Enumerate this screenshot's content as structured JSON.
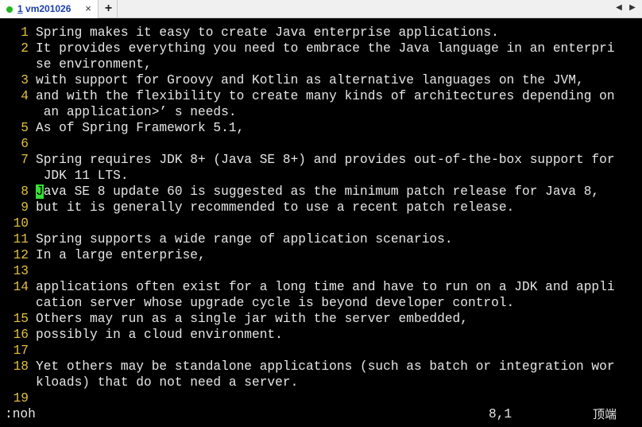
{
  "tabbar": {
    "active_tab": {
      "index": "1",
      "name": " vm201026",
      "close_glyph": "×",
      "status_color": "#1fb81f"
    },
    "add_tab_glyph": "+",
    "prev_glyph": "◀",
    "next_glyph": "▶"
  },
  "editor": {
    "rows": [
      {
        "num": "1",
        "text": "Spring makes it easy to create Java enterprise applications."
      },
      {
        "num": "2",
        "text": "It provides everything you need to embrace the Java language in an enterpri"
      },
      {
        "num": "",
        "text": "se environment,"
      },
      {
        "num": "3",
        "text": "with support for Groovy and Kotlin as alternative languages on the JVM,"
      },
      {
        "num": "4",
        "text": "and with the flexibility to create many kinds of architectures depending on"
      },
      {
        "num": "",
        "text": " an application>’ s needs."
      },
      {
        "num": "5",
        "text": "As of Spring Framework 5.1,"
      },
      {
        "num": "6",
        "text": ""
      },
      {
        "num": "7",
        "text": "Spring requires JDK 8+ (Java SE 8+) and provides out-of-the-box support for"
      },
      {
        "num": "",
        "text": " JDK 11 LTS."
      },
      {
        "num": "8",
        "cursor_char": "J",
        "text": "ava SE 8 update 60 is suggested as the minimum patch release for Java 8,"
      },
      {
        "num": "9",
        "text": "but it is generally recommended to use a recent patch release."
      },
      {
        "num": "10",
        "text": ""
      },
      {
        "num": "11",
        "text": "Spring supports a wide range of application scenarios."
      },
      {
        "num": "12",
        "text": "In a large enterprise,"
      },
      {
        "num": "13",
        "text": ""
      },
      {
        "num": "14",
        "text": "applications often exist for a long time and have to run on a JDK and appli"
      },
      {
        "num": "",
        "text": "cation server whose upgrade cycle is beyond developer control."
      },
      {
        "num": "15",
        "text": "Others may run as a single jar with the server embedded,"
      },
      {
        "num": "16",
        "text": "possibly in a cloud environment."
      },
      {
        "num": "17",
        "text": ""
      },
      {
        "num": "18",
        "text": "Yet others may be standalone applications (such as batch or integration wor"
      },
      {
        "num": "",
        "text": "kloads) that do not need a server."
      },
      {
        "num": "19",
        "text": ""
      }
    ],
    "colors": {
      "background": "#000000",
      "text": "#e6e6e6",
      "line_number": "#e2c13c",
      "cursor": "#35e035"
    }
  },
  "statusline": {
    "command": ":noh",
    "cursor_position": "8,1",
    "scroll_position": "顶端"
  }
}
